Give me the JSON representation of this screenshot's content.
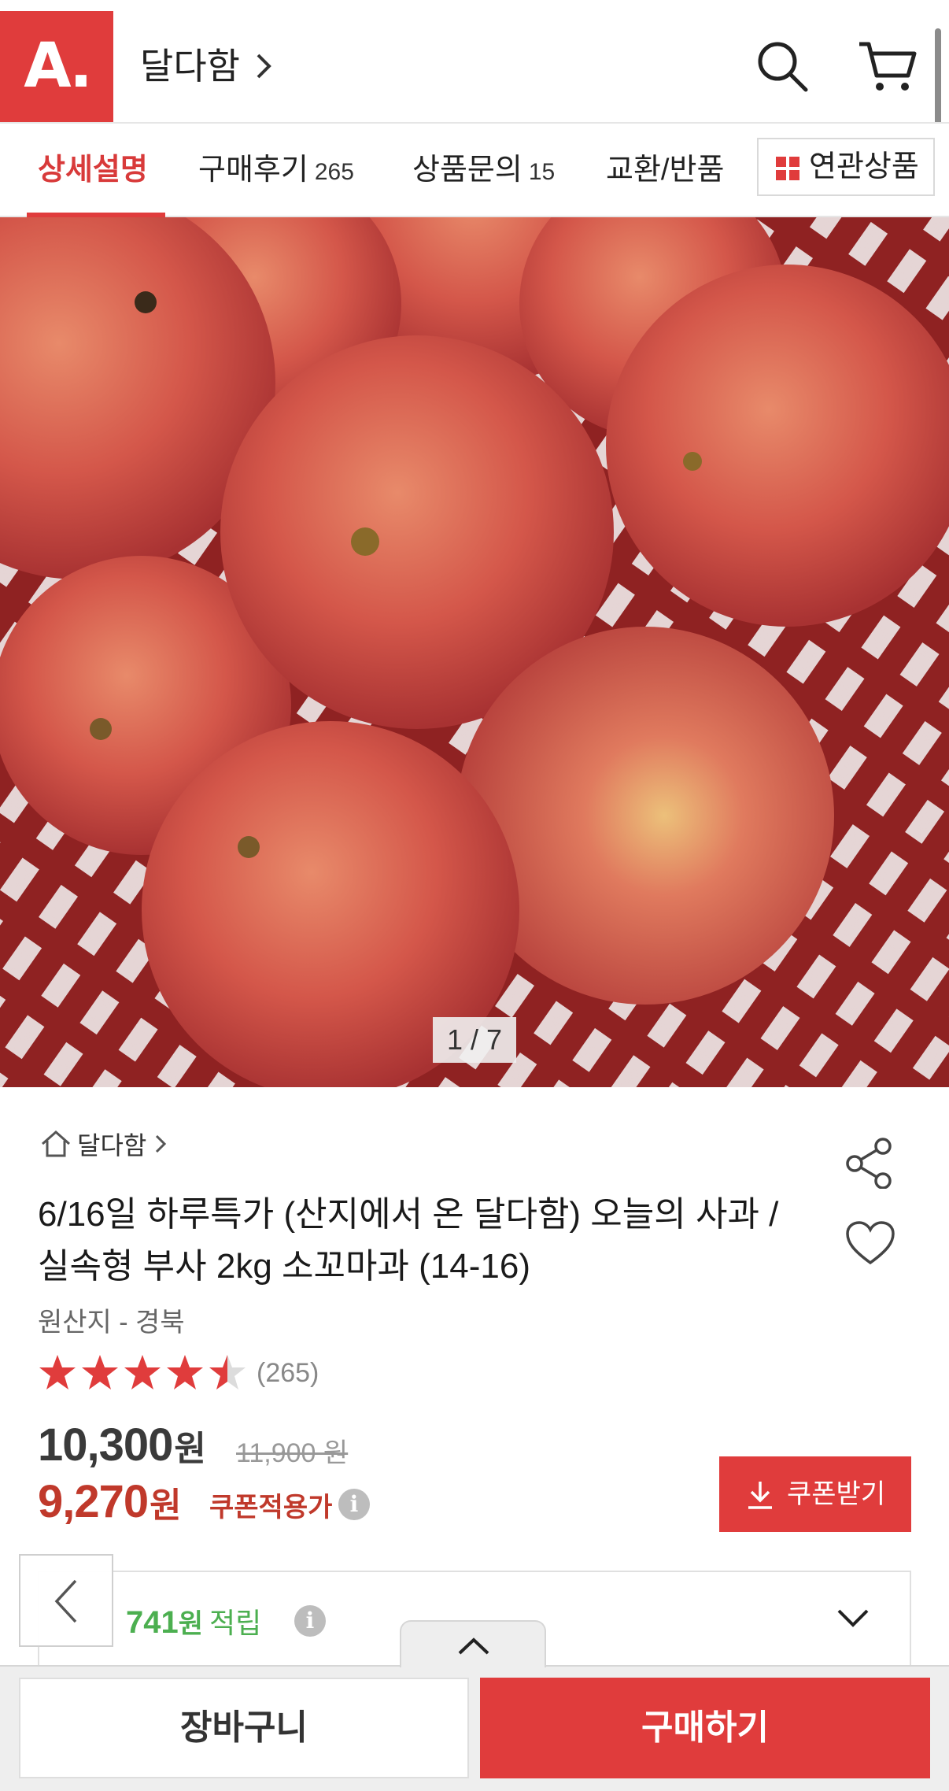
{
  "header": {
    "logo_text": "A.",
    "store_name": "달다함",
    "icons": [
      "search-icon",
      "cart-icon"
    ]
  },
  "tabs": [
    {
      "label": "상세설명",
      "count": "",
      "active": true
    },
    {
      "label": "구매후기",
      "count": "265",
      "active": false
    },
    {
      "label": "상품문의",
      "count": "15",
      "active": false
    },
    {
      "label": "교환/반품",
      "count": "",
      "active": false
    }
  ],
  "related_button": {
    "label": "연관상품",
    "icon": "grid-icon"
  },
  "gallery": {
    "counter": "1 / 7"
  },
  "product": {
    "brand": "달다함",
    "title": "6/16일 하루특가 (산지에서 온 달다함) 오늘의 사과 / 실속형 부사 2kg 소꼬마과 (14-16)",
    "origin": "원산지 - 경북",
    "rating": 4.5,
    "review_count": "(265)",
    "price": "10,300",
    "price_unit": "원",
    "original_price": "11,900 원",
    "coupon_price": "9,270",
    "coupon_price_unit": "원",
    "coupon_label": "쿠폰적용가",
    "coupon_button": "쿠폰받기",
    "points": "741",
    "points_unit": "원",
    "points_label": "적립"
  },
  "bottom_bar": {
    "cart_label": "장바구니",
    "buy_label": "구매하기"
  },
  "colors": {
    "brand": "#e03c3c",
    "sale": "#c0392b",
    "points": "#4caf50"
  }
}
